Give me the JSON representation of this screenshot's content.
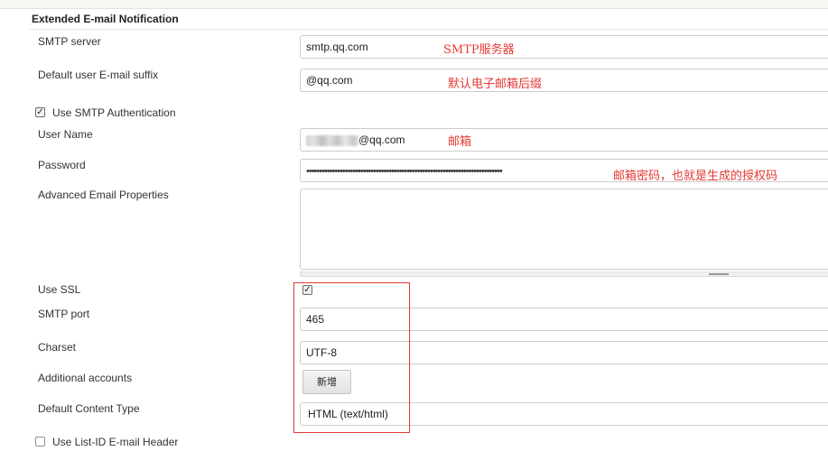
{
  "section": {
    "title": "Extended E-mail Notification"
  },
  "fields": {
    "smtp_server": {
      "label": "SMTP server",
      "value": "smtp.qq.com"
    },
    "default_suffix": {
      "label": "Default user E-mail suffix",
      "value": "@qq.com"
    },
    "use_smtp_auth": {
      "label": "Use SMTP Authentication",
      "checked": true
    },
    "user_name": {
      "label": "User Name",
      "value": "@qq.com"
    },
    "password": {
      "label": "Password",
      "value": "••••••••••••••••••••••••••••••••••••••••••••••••••••••••••••••••••••••••••••"
    },
    "advanced_props": {
      "label": "Advanced Email Properties",
      "value": ""
    },
    "use_ssl": {
      "label": "Use SSL",
      "checked": true
    },
    "smtp_port": {
      "label": "SMTP port",
      "value": "465"
    },
    "charset": {
      "label": "Charset",
      "value": "UTF-8"
    },
    "additional_accounts": {
      "label": "Additional accounts",
      "button": "新增"
    },
    "content_type": {
      "label": "Default Content Type",
      "value": "HTML (text/html)"
    },
    "list_id_header": {
      "label": "Use List-ID E-mail Header",
      "checked": false
    }
  },
  "annotations": {
    "smtp_server": "SMTP服务器",
    "default_suffix": "默认电子邮箱后缀",
    "user_name": "邮箱",
    "password": "邮箱密码，也就是生成的授权码"
  },
  "colors": {
    "annotation": "#e53935",
    "highlight_box": "#e53935"
  }
}
